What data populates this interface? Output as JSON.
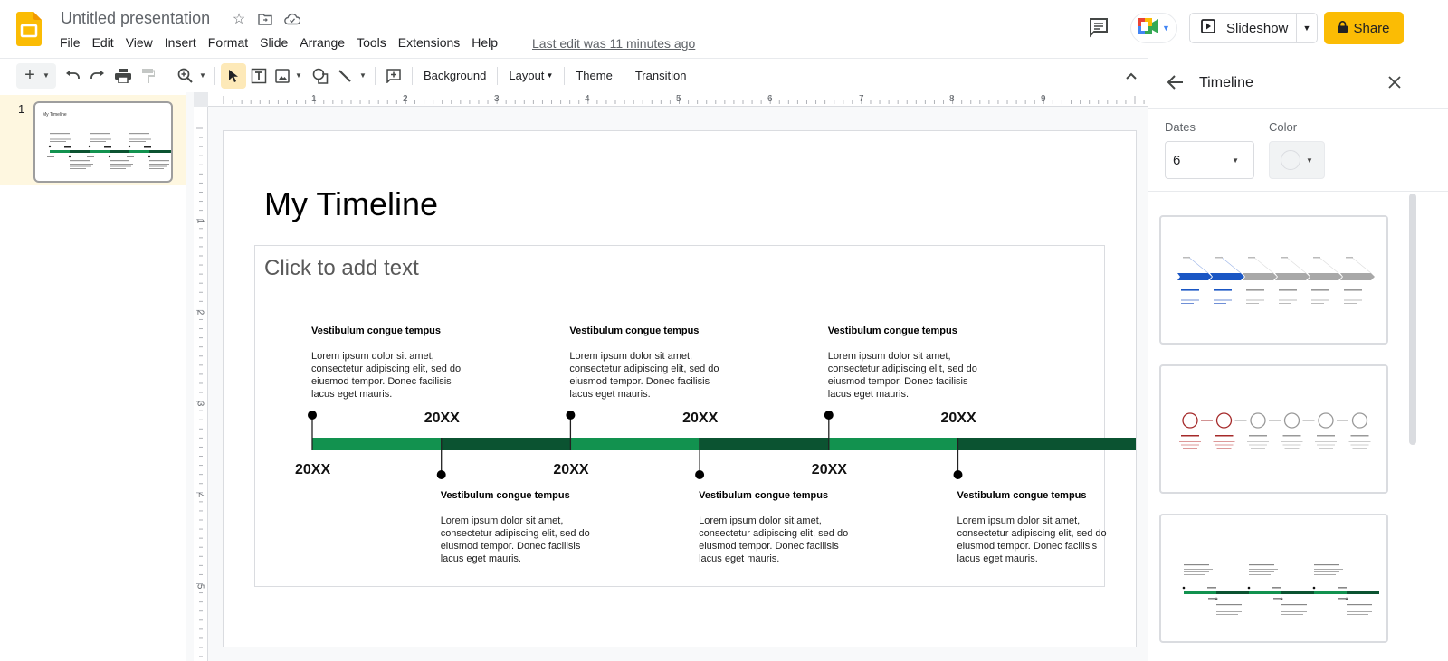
{
  "app": {
    "title": "Untitled presentation",
    "menu": [
      "File",
      "Edit",
      "View",
      "Insert",
      "Format",
      "Slide",
      "Arrange",
      "Tools",
      "Extensions",
      "Help"
    ],
    "last_edit": "Last edit was 11 minutes ago",
    "slideshow_label": "Slideshow",
    "share_label": "Share",
    "icons": {
      "star": "star-icon",
      "move": "move-to-folder-icon",
      "cloud": "cloud-saved-icon",
      "comment": "comment-history-icon",
      "meet": "google-meet-icon",
      "lock": "lock-icon"
    }
  },
  "toolbar": {
    "background_label": "Background",
    "layout_label": "Layout",
    "theme_label": "Theme",
    "transition_label": "Transition"
  },
  "filmstrip": {
    "slides": [
      {
        "number": "1",
        "title": "My Timeline"
      }
    ]
  },
  "rulers": {
    "horizontal": [
      "1",
      "2",
      "3",
      "4",
      "5",
      "6",
      "7",
      "8",
      "9"
    ],
    "vertical": [
      "1",
      "2",
      "3",
      "4",
      "5"
    ]
  },
  "slide": {
    "title": "My Timeline",
    "body_placeholder": "Click to add text",
    "timeline": {
      "colors": {
        "light": "#12924f",
        "dark": "#0b5331"
      },
      "events": [
        {
          "position": "top",
          "heading": "Vestibulum congue tempus",
          "body": "Lorem ipsum dolor sit amet, consectetur adipiscing elit, sed do eiusmod tempor. Donec facilisis lacus eget mauris.",
          "year": "20XX"
        },
        {
          "position": "bottom",
          "heading": "Vestibulum congue tempus",
          "body": "Lorem ipsum dolor sit amet, consectetur adipiscing elit, sed do eiusmod tempor. Donec facilisis lacus eget mauris.",
          "year": "20XX"
        },
        {
          "position": "top",
          "heading": "Vestibulum congue tempus",
          "body": "Lorem ipsum dolor sit amet, consectetur adipiscing elit, sed do eiusmod tempor. Donec facilisis lacus eget mauris.",
          "year": "20XX"
        },
        {
          "position": "bottom",
          "heading": "Vestibulum congue tempus",
          "body": "Lorem ipsum dolor sit amet, consectetur adipiscing elit, sed do eiusmod tempor. Donec facilisis lacus eget mauris.",
          "year": "20XX"
        },
        {
          "position": "top",
          "heading": "Vestibulum congue tempus",
          "body": "Lorem ipsum dolor sit amet, consectetur adipiscing elit, sed do eiusmod tempor. Donec facilisis lacus eget mauris.",
          "year": "20XX"
        },
        {
          "position": "bottom",
          "heading": "Vestibulum congue tempus",
          "body": "Lorem ipsum dolor sit amet, consectetur adipiscing elit, sed do eiusmod tempor. Donec facilisis lacus eget mauris.",
          "year": "20XX"
        }
      ]
    }
  },
  "panel": {
    "title": "Timeline",
    "dates_label": "Dates",
    "dates_value": "6",
    "color_label": "Color",
    "templates": [
      {
        "name": "chevron-timeline",
        "accent": "#1a56c4"
      },
      {
        "name": "circle-timeline",
        "accent": "#a52a2a"
      },
      {
        "name": "alternating-bar-timeline",
        "accent": "#12924f"
      }
    ]
  }
}
